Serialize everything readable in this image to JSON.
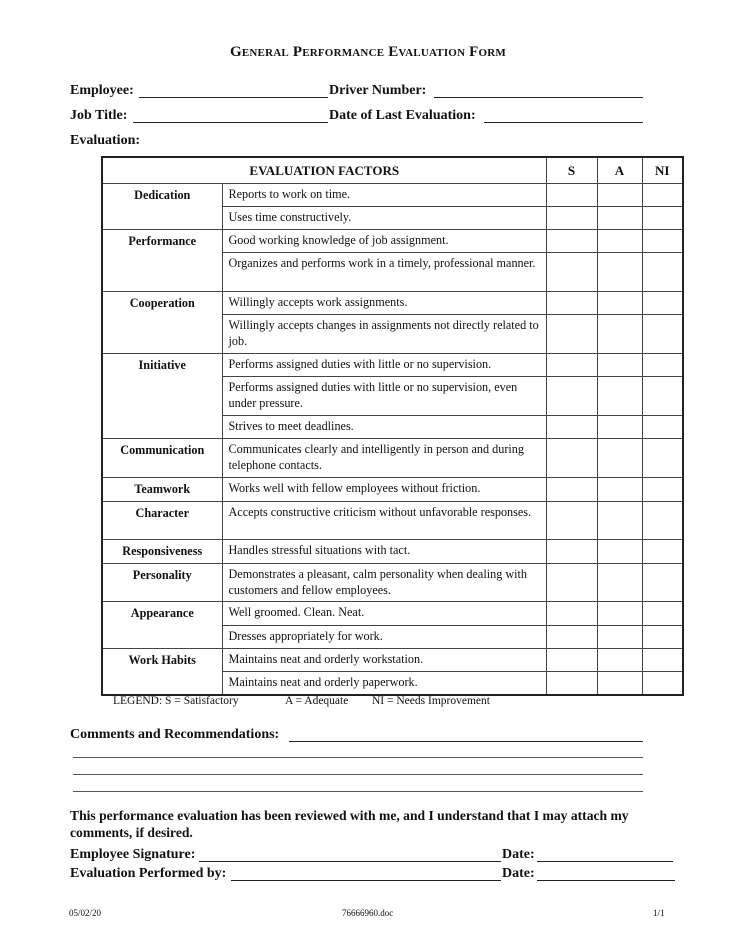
{
  "title": "General Performance Evaluation Form",
  "fields": {
    "employee_label": "Employee:",
    "employee_value": "",
    "driver_number_label": "Driver Number:",
    "driver_number_value": "",
    "job_title_label": "Job Title:",
    "job_title_value": "",
    "date_last_eval_label": "Date of Last Evaluation:",
    "date_last_eval_value": "",
    "evaluation_label": "Evaluation:"
  },
  "table": {
    "header_factors": "EVALUATION FACTORS",
    "header_s": "S",
    "header_a": "A",
    "header_ni": "NI",
    "groups": [
      {
        "category": "Dedication",
        "items": [
          "Reports to work on time.",
          "Uses time constructively."
        ]
      },
      {
        "category": "Performance",
        "items": [
          "Good working knowledge of job assignment.",
          "Organizes and performs work in a timely, professional manner."
        ]
      },
      {
        "category": "Cooperation",
        "items": [
          "Willingly accepts work assignments.",
          "Willingly accepts changes in assignments not directly related to job."
        ]
      },
      {
        "category": "Initiative",
        "items": [
          "Performs assigned duties with little or no supervision.",
          "Performs assigned duties with little or no supervision, even under pressure.",
          "Strives to meet deadlines."
        ]
      },
      {
        "category": "Communication",
        "items": [
          "Communicates clearly and intelligently in person and during telephone contacts."
        ]
      },
      {
        "category": "Teamwork",
        "items": [
          "Works well with fellow employees without friction."
        ]
      },
      {
        "category": "Character",
        "items": [
          "Accepts constructive criticism without unfavorable responses."
        ]
      },
      {
        "category": "Responsiveness",
        "items": [
          "Handles stressful situations with tact."
        ]
      },
      {
        "category": "Personality",
        "items": [
          "Demonstrates a pleasant, calm personality when dealing with customers and fellow employees."
        ]
      },
      {
        "category": "Appearance",
        "items": [
          "Well groomed.  Clean.  Neat.",
          "Dresses appropriately for work."
        ]
      },
      {
        "category": "Work Habits",
        "items": [
          "Maintains neat and orderly workstation.",
          "Maintains neat and orderly paperwork."
        ]
      }
    ]
  },
  "legend": {
    "prefix": "LEGEND:  S = Satisfactory",
    "adequate": "A = Adequate",
    "needs_improvement": "NI = Needs Improvement"
  },
  "comments": {
    "label": "Comments and Recommendations:",
    "lines": [
      "",
      "",
      "",
      ""
    ]
  },
  "statement": "This performance evaluation has been reviewed with me, and I understand that I may attach my comments, if desired.",
  "signatures": {
    "employee_signature_label": "Employee Signature:",
    "employee_signature_value": "",
    "employee_date_label": "Date:",
    "employee_date_value": "",
    "performed_by_label": "Evaluation Performed by:",
    "performed_by_value": "",
    "performed_date_label": "Date:",
    "performed_date_value": ""
  },
  "footer": {
    "date": "05/02/20",
    "filename": "76666960.doc",
    "page": "1/1"
  }
}
